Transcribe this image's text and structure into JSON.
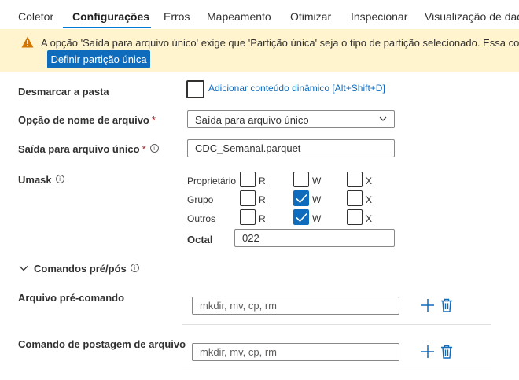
{
  "tabs": [
    {
      "label": "Coletor"
    },
    {
      "label": "Configurações"
    },
    {
      "label": "Erros"
    },
    {
      "label": "Mapeamento"
    },
    {
      "label": "Otimizar"
    },
    {
      "label": "Inspecionar"
    },
    {
      "label": "Visualização de dad"
    }
  ],
  "banner": {
    "message": "A opção 'Saída para arquivo único' exige que 'Partição única' seja o tipo de partição selecionado. Essa conf",
    "button_label": "Definir partição única",
    "icon": "warning-icon",
    "color": "#fff4ce"
  },
  "clear_folder": {
    "label": "Desmarcar a pasta",
    "dynamic_link": "Adicionar conteúdo dinâmico [Alt+Shift+D]"
  },
  "file_name_option": {
    "label": "Opção de nome de arquivo",
    "required": "*",
    "value": "Saída para arquivo único"
  },
  "single_file_output": {
    "label": "Saída para arquivo único",
    "required": "*",
    "info": "i",
    "value": "CDC_Semanal.parquet"
  },
  "umask": {
    "label": "Umask",
    "info": "i",
    "rows": [
      {
        "name": "Proprietário",
        "R": false,
        "W": false,
        "X": false
      },
      {
        "name": "Grupo",
        "R": false,
        "W": true,
        "X": false
      },
      {
        "name": "Outros",
        "R": false,
        "W": true,
        "X": false
      }
    ],
    "bits": [
      "R",
      "W",
      "X"
    ],
    "octal_label": "Octal",
    "octal_value": "022"
  },
  "prepost": {
    "label": "Comandos pré/pós",
    "info": "i",
    "pre_label": "Arquivo pré-comando",
    "pre_placeholder": "mkdir, mv, cp, rm",
    "post_label": "Comando de postagem de arquivo",
    "post_placeholder": "mkdir, mv, cp, rm"
  },
  "colors": {
    "accent": "#0f6cbd",
    "warning": "#d47500"
  }
}
